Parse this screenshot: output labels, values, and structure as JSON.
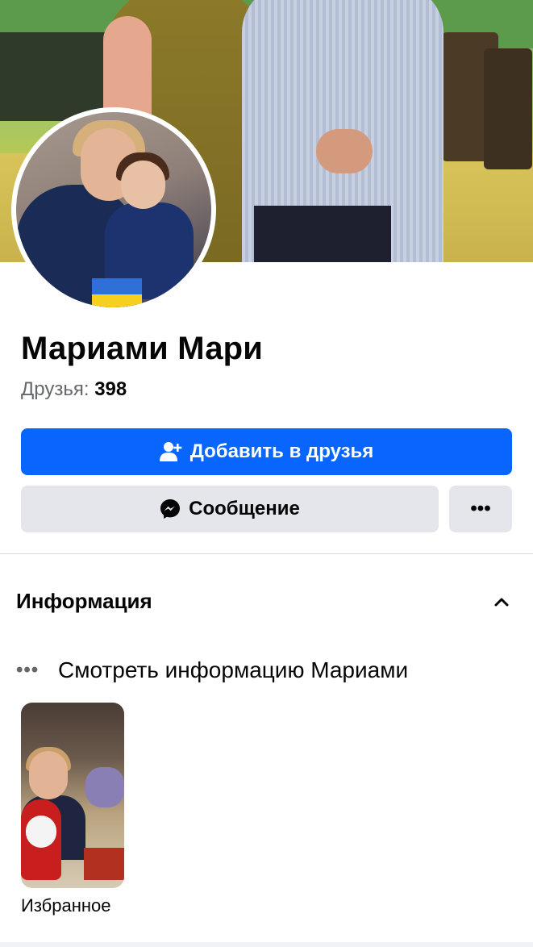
{
  "profile": {
    "name": "Мариами Мари",
    "friends_label": "Друзья:",
    "friends_count": "398"
  },
  "actions": {
    "add_friend_label": "Добавить в друзья",
    "message_label": "Сообщение",
    "more_label": "•••"
  },
  "info_section": {
    "title": "Информация",
    "see_info_label": "Смотреть информацию Мариами"
  },
  "featured": {
    "label": "Избранное"
  },
  "colors": {
    "primary": "#0866ff",
    "secondary_button": "#e4e6eb",
    "text": "#050505",
    "muted_text": "#65676b"
  },
  "icons": {
    "add_friend": "add-friend-icon",
    "messenger": "messenger-icon",
    "more": "more-icon",
    "chevron": "chevron-up-icon",
    "dots": "dots-icon"
  }
}
